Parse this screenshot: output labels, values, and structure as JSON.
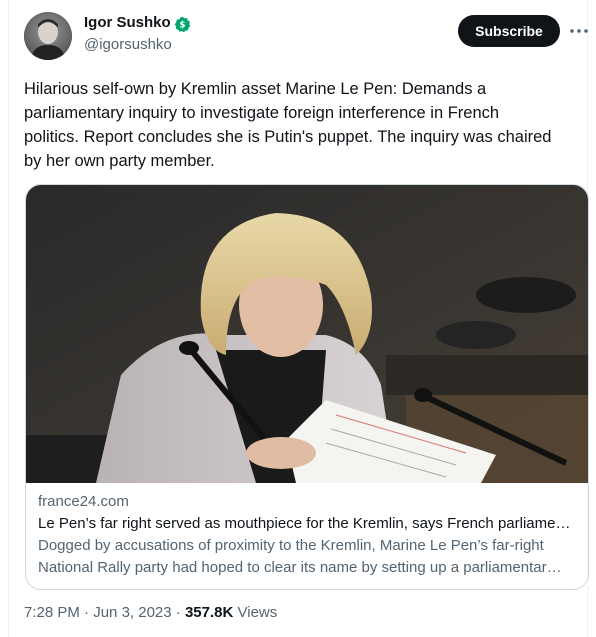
{
  "author": {
    "name": "Igor Sushko",
    "handle": "@igorsushko",
    "verified_badge_color": "#00a66c"
  },
  "actions": {
    "subscribe_label": "Subscribe",
    "more_icon": "more-horizontal-icon"
  },
  "tweet": {
    "text": "Hilarious self-own by Kremlin asset Marine Le Pen: Demands a\nparliamentary inquiry to investigate foreign interference in French\npolitics. Report concludes she is Putin's puppet. The inquiry was chaired\nby her own party member."
  },
  "card": {
    "domain": "france24.com",
    "title": "Le Pen’s far right served as mouthpiece for the Kremlin, says French parliame…",
    "description": "Dogged by accusations of proximity to the Kremlin, Marine Le Pen’s far-right National Rally party had hoped to clear its name by setting up a parliamentar…"
  },
  "meta": {
    "time": "7:28 PM",
    "separator": "·",
    "date": "Jun 3, 2023",
    "views_count": "357.8K",
    "views_label": "Views"
  },
  "colors": {
    "text_primary": "#0f1419",
    "text_secondary": "#536471",
    "border": "#cfd9de",
    "button_bg": "#0f1419"
  }
}
